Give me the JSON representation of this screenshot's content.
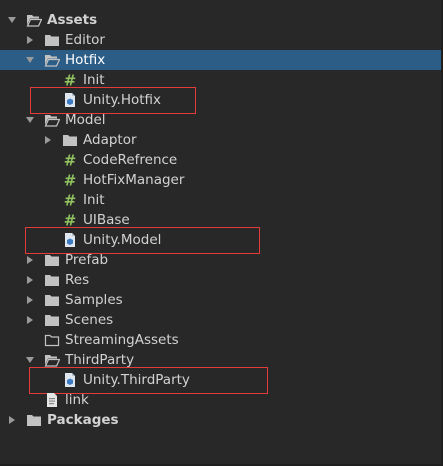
{
  "project_tree": {
    "items": [
      {
        "label": "Assets",
        "type": "folder-open",
        "depth": 0,
        "expanded": true,
        "bold": true
      },
      {
        "label": "Editor",
        "type": "folder",
        "depth": 1,
        "expanded": false
      },
      {
        "label": "Hotfix",
        "type": "folder-open",
        "depth": 1,
        "expanded": true,
        "selected": true
      },
      {
        "label": "Init",
        "type": "script",
        "depth": 2
      },
      {
        "label": "Unity.Hotfix",
        "type": "asmdef",
        "depth": 2,
        "highlighted": true
      },
      {
        "label": "Model",
        "type": "folder-open",
        "depth": 1,
        "expanded": true
      },
      {
        "label": "Adaptor",
        "type": "folder",
        "depth": 2,
        "expanded": false
      },
      {
        "label": "CodeRefrence",
        "type": "script",
        "depth": 2
      },
      {
        "label": "HotFixManager",
        "type": "script",
        "depth": 2
      },
      {
        "label": "Init",
        "type": "script",
        "depth": 2
      },
      {
        "label": "UIBase",
        "type": "script",
        "depth": 2
      },
      {
        "label": "Unity.Model",
        "type": "asmdef",
        "depth": 2,
        "highlighted": true
      },
      {
        "label": "Prefab",
        "type": "folder",
        "depth": 1,
        "expanded": false
      },
      {
        "label": "Res",
        "type": "folder",
        "depth": 1,
        "expanded": false
      },
      {
        "label": "Samples",
        "type": "folder",
        "depth": 1,
        "expanded": false
      },
      {
        "label": "Scenes",
        "type": "folder",
        "depth": 1,
        "expanded": false
      },
      {
        "label": "StreamingAssets",
        "type": "folder-empty",
        "depth": 1
      },
      {
        "label": "ThirdParty",
        "type": "folder-open",
        "depth": 1,
        "expanded": true
      },
      {
        "label": "Unity.ThirdParty",
        "type": "asmdef",
        "depth": 2,
        "highlighted": true
      },
      {
        "label": "link",
        "type": "text-file",
        "depth": 1
      },
      {
        "label": "Packages",
        "type": "folder",
        "depth": 0,
        "expanded": false,
        "bold": true
      }
    ]
  },
  "colors": {
    "background": "#282828",
    "selection": "#2c5d87",
    "highlight_box": "#e23b3b",
    "script_icon": "#8fc15f",
    "folder_icon": "#c2c2c2"
  }
}
